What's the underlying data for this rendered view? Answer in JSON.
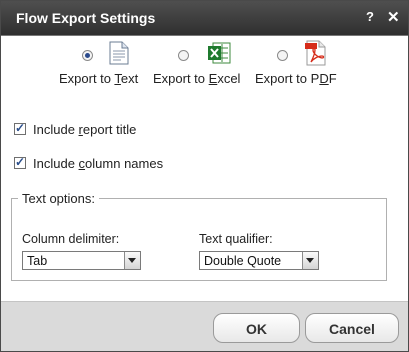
{
  "dialog": {
    "title": "Flow Export Settings",
    "help_icon": "?",
    "close_icon": "✕"
  },
  "export_options": [
    {
      "label_pre": "Export to ",
      "label_u": "T",
      "label_post": "ext",
      "icon": "text-file-icon",
      "selected": true
    },
    {
      "label_pre": "Export to ",
      "label_u": "E",
      "label_post": "xcel",
      "icon": "excel-icon",
      "selected": false
    },
    {
      "label_pre": "Export to P",
      "label_u": "D",
      "label_post": "F",
      "icon": "pdf-icon",
      "selected": false
    }
  ],
  "checkboxes": [
    {
      "label_pre": "Include ",
      "label_u": "r",
      "label_post": "eport title",
      "checked": true
    },
    {
      "label_pre": "Include ",
      "label_u": "c",
      "label_post": "olumn names",
      "checked": true
    }
  ],
  "text_options": {
    "legend": "Text options:",
    "column_delimiter": {
      "label": "Column delimiter:",
      "value": "Tab"
    },
    "text_qualifier": {
      "label": "Text qualifier:",
      "value": "Double Quote"
    }
  },
  "buttons": {
    "ok": "OK",
    "cancel": "Cancel"
  }
}
